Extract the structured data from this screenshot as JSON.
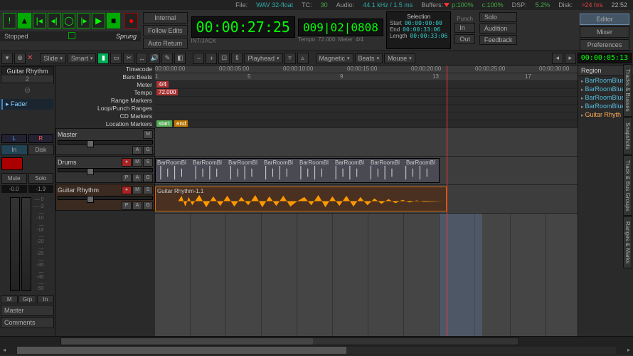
{
  "info": {
    "file_lbl": "File:",
    "file": "WAV 32-float",
    "tc_lbl": "TC:",
    "tc": "30",
    "audio_lbl": "Audio:",
    "audio": "44.1 kHz / 1.5 ms",
    "buf_lbl": "Buffers:",
    "buf_p": "p:100%",
    "buf_c": "c:100%",
    "dsp_lbl": "DSP:",
    "dsp": "5.2%",
    "disk_lbl": "Disk:",
    "disk": ">24 hrs",
    "time": "22:52"
  },
  "status": {
    "state": "Stopped",
    "mode": "Sprung"
  },
  "hdr": {
    "internal": "Internal",
    "follow": "Follow Edits",
    "autoreturn": "Auto Return",
    "clock1": "00:00:27:25",
    "clock2": "009|02|0808",
    "intjack": "INT/JACK",
    "tempo_lbl": "Tempo",
    "tempo": "72.000",
    "meter_lbl": "Meter",
    "meter": "4/4",
    "sel_lbl": "Selection",
    "start_lbl": "Start",
    "start": "00:00:00:00",
    "end_lbl": "End",
    "end": "00:00:33:06",
    "len_lbl": "Length",
    "len": "00:00:33:06",
    "punch_lbl": "Punch",
    "in": "In",
    "out": "Out",
    "solo": "Solo",
    "audition": "Audition",
    "feedback": "Feedback",
    "editor": "Editor",
    "mixer": "Mixer",
    "prefs": "Preferences"
  },
  "tb": {
    "slide": "Slide",
    "smart": "Smart",
    "playhead": "Playhead",
    "magnetic": "Magnetic",
    "beats": "Beats",
    "mouse": "Mouse",
    "mini": "00:00:05:13"
  },
  "rulers": {
    "labels": [
      "Timecode",
      "Bars:Beats",
      "Meter",
      "Tempo",
      "Range Markers",
      "Loop/Punch Ranges",
      "CD Markers",
      "Location Markers"
    ],
    "tc_ticks": [
      "00:00:00:00",
      "00:00:05:00",
      "00:00:10:00",
      "00:00:15:00",
      "00:00:20:00",
      "00:00:25:00",
      "00:00:30:00"
    ],
    "bar_ticks": [
      "1",
      "5",
      "9",
      "13",
      "17"
    ],
    "meter_chip": "4/4",
    "tempo_chip": "72.000",
    "loc_start": "start",
    "loc_end": "end"
  },
  "tracks": {
    "master": "Master",
    "drums": "Drums",
    "guitar": "Guitar Rhythm",
    "btn_m": "M",
    "btn_s": "S",
    "btn_a": "A",
    "btn_g": "G",
    "btn_p": "P",
    "reg_drums": "BarRoomBl",
    "reg_guitar": "Guitar Rhythm-1.1"
  },
  "left": {
    "ch": "Guitar Rhythm",
    "num": "2",
    "theta": "ϴ",
    "fader": "Fader",
    "l": "L",
    "r": "R",
    "in": "In",
    "disk": "Disk",
    "mute": "Mute",
    "solo": "Solo",
    "db1": "-0.0",
    "db2": "-1.9",
    "ticks": [
      "— 0",
      "— -3",
      "— -10",
      "— -18",
      "— -20",
      "— -25",
      "— -30",
      "— -40",
      "— -50"
    ],
    "m": "M",
    "grp": "Grp",
    "inb": "In",
    "mstr": "Master",
    "cmt": "Comments"
  },
  "right": {
    "hdr": "Region",
    "items": [
      "BarRoomBlue",
      "BarRoomBlue",
      "BarRoomBlue",
      "BarRoomBlue"
    ],
    "sel": "Guitar Rhyth",
    "tabs": [
      "Tracks & Busses",
      "Snapshots",
      "Track & Bus Groups",
      "Ranges & Marks"
    ]
  }
}
